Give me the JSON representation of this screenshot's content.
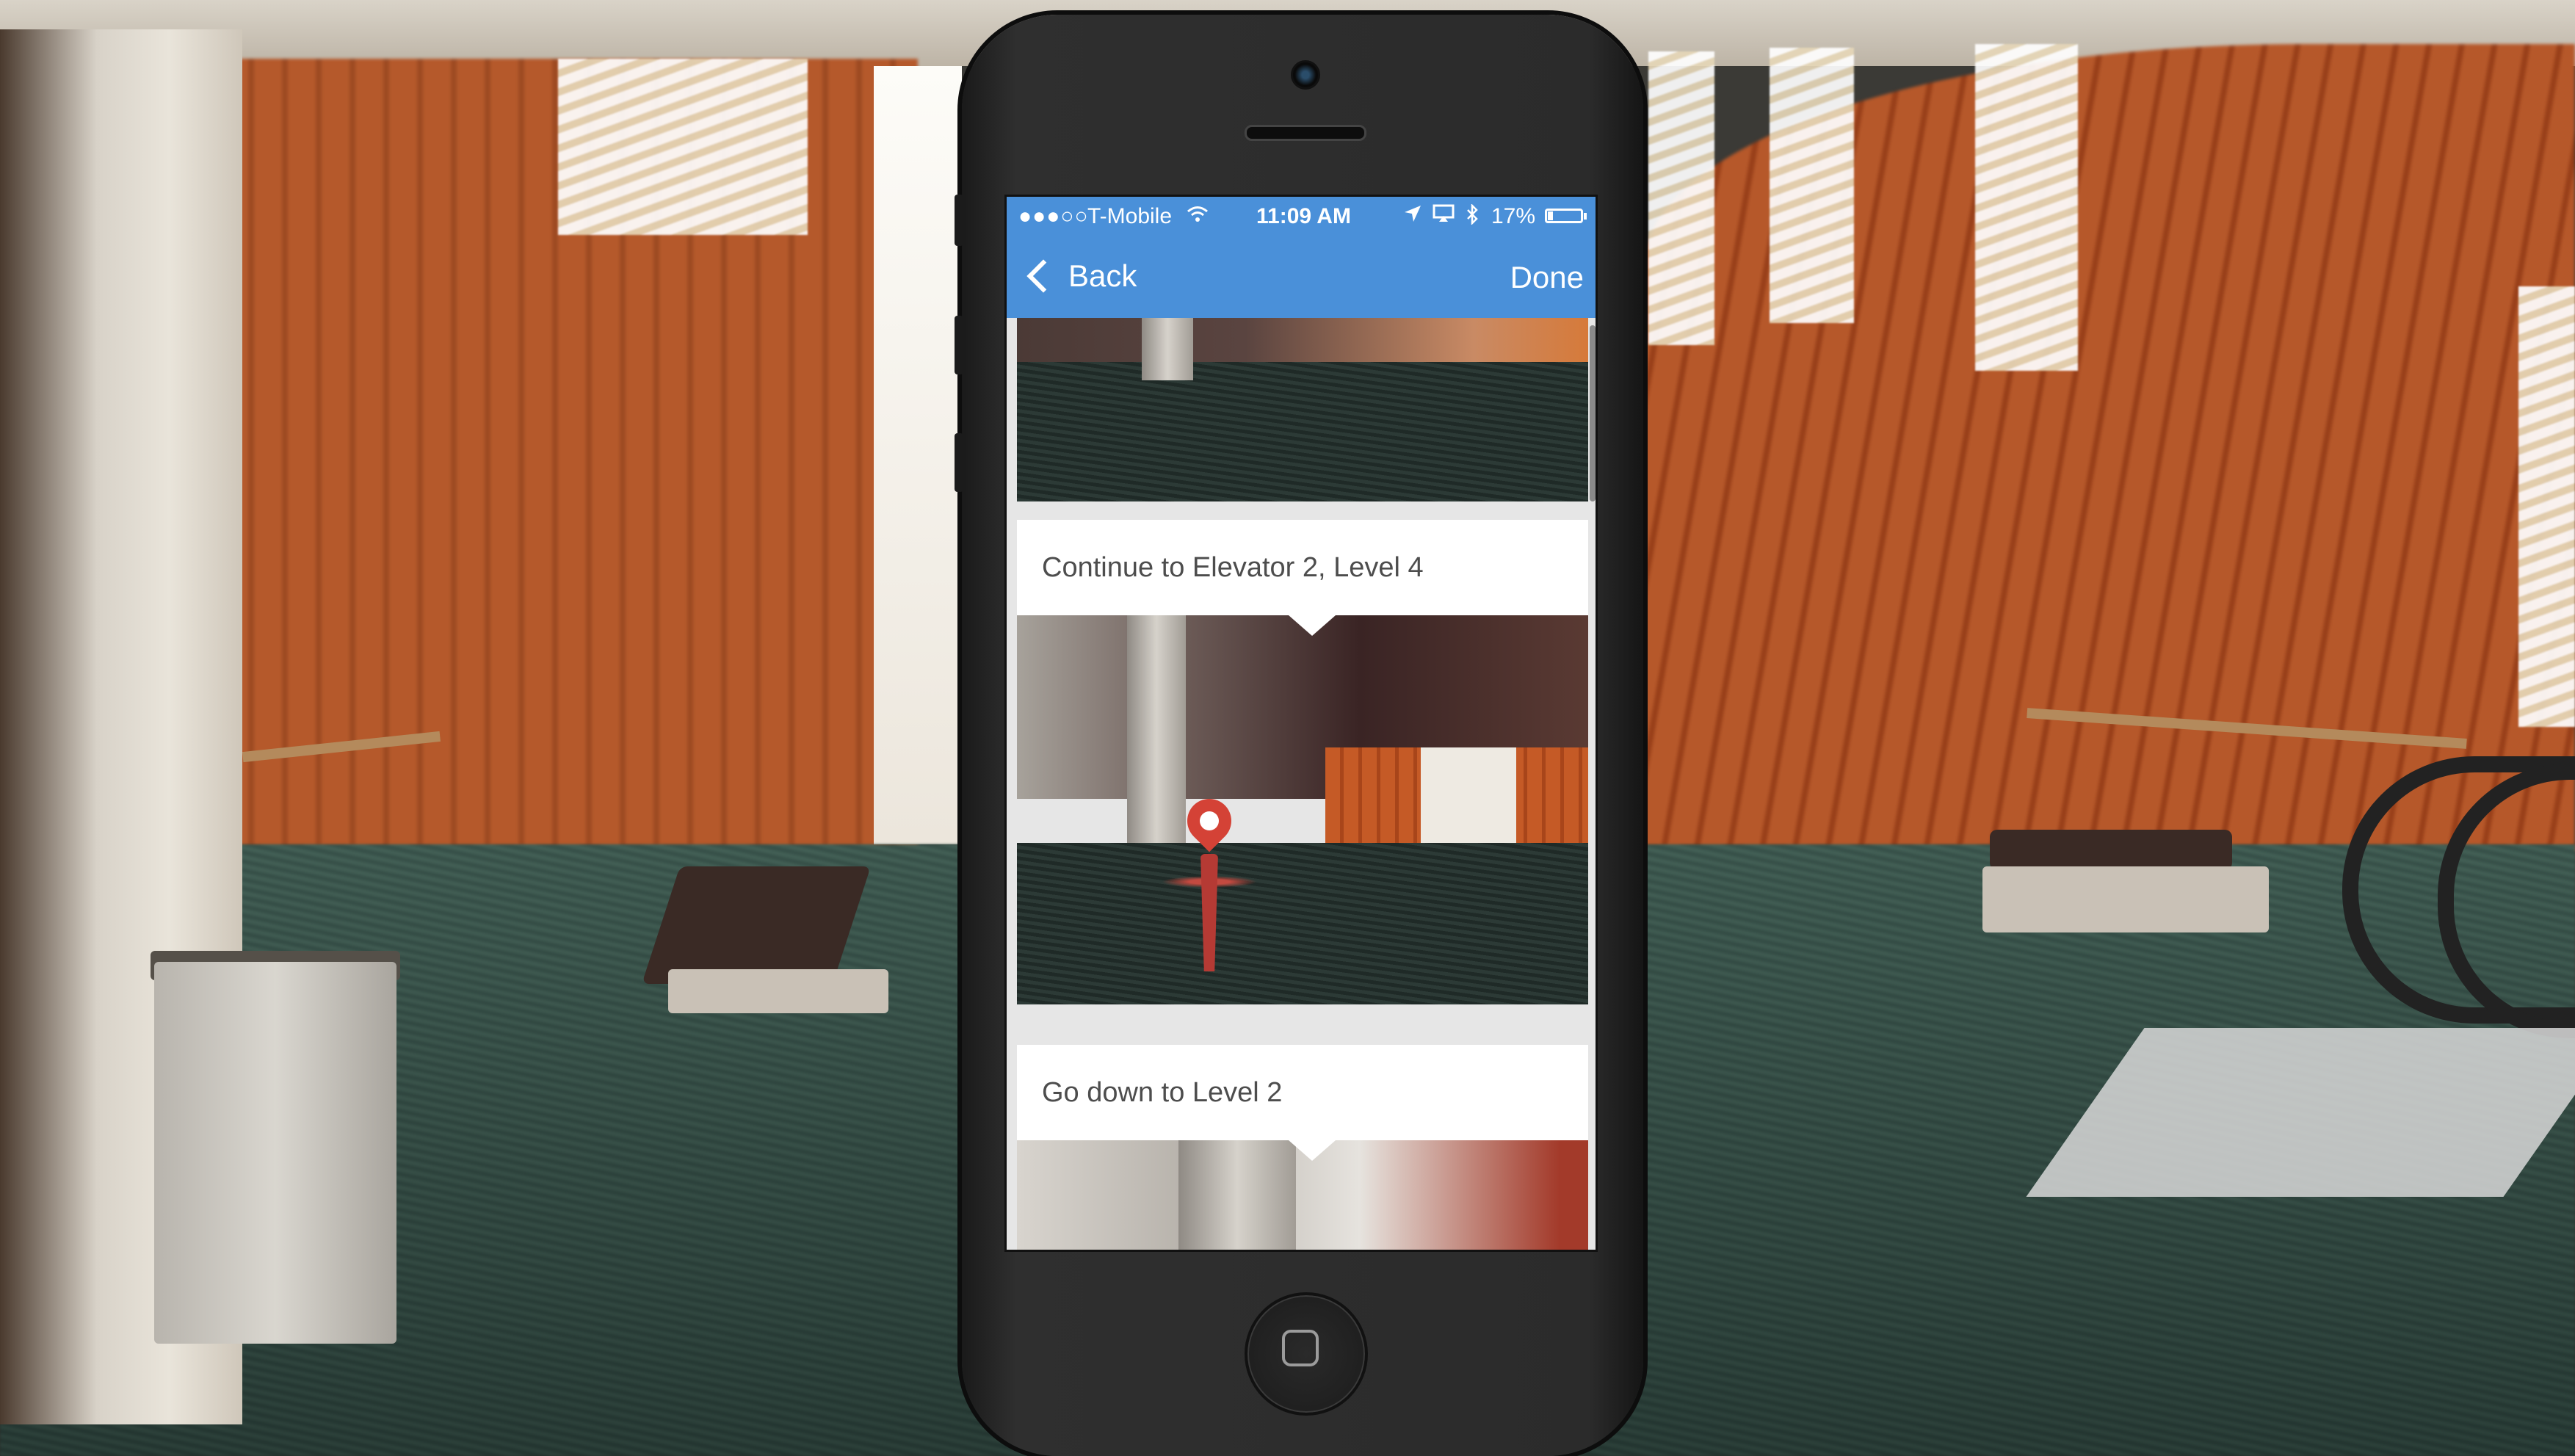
{
  "status_bar": {
    "signal": "●●●○○",
    "carrier": "T-Mobile",
    "wifi_icon": "wifi-icon",
    "time": "11:09 AM",
    "location_icon": "location-arrow-icon",
    "bluetooth_icon": "bluetooth-icon",
    "battery_percent": "17%",
    "battery_level": 0.17
  },
  "nav": {
    "back_label": "Back",
    "done_label": "Done",
    "accent_color": "#4a90d9"
  },
  "steps": [
    {
      "text": "Continue to Elevator 2, Level 4"
    },
    {
      "text": "Go down to Level 2"
    }
  ]
}
